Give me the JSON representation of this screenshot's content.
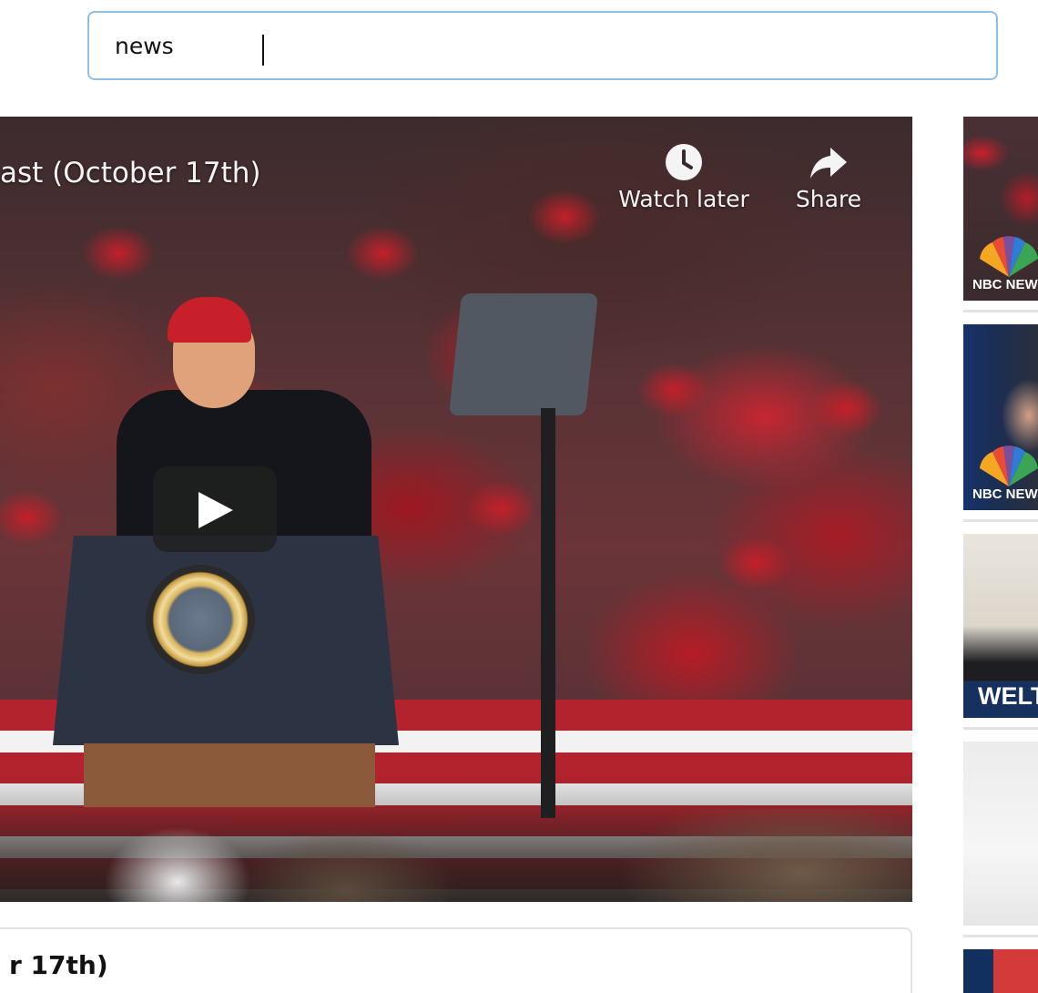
{
  "search": {
    "value": "news"
  },
  "player": {
    "title": "ast (October 17th)",
    "watch_later_label": "Watch later",
    "share_label": "Share"
  },
  "video_info": {
    "title": "r 17th)"
  },
  "sidebar": {
    "thumbnails": [
      {
        "overlay_text": "NBC NEWS"
      },
      {
        "overlay_text": "NBC NEWS"
      },
      {
        "overlay_text": "WELT"
      },
      {
        "overlay_text": ""
      },
      {
        "overlay_text": ""
      }
    ]
  },
  "icons": {
    "watch_later": "clock-icon",
    "share": "share-arrow-icon",
    "play": "play-icon"
  },
  "colors": {
    "search_border": "#8ec0e4",
    "play_button_bg": "#202020",
    "card_border": "#e2e2e2"
  }
}
